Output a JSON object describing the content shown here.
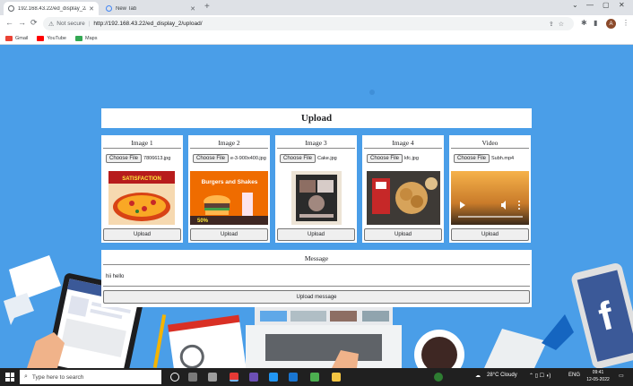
{
  "browser": {
    "tabs": [
      {
        "title": "192.168.43.22/ed_display_2/uplo",
        "active": true
      },
      {
        "title": "New Tab",
        "active": false
      }
    ],
    "new_tab": "+",
    "nav": {
      "back": "←",
      "forward": "→",
      "reload": "⟳"
    },
    "omnibox": {
      "security": "Not secure",
      "separator": "|",
      "url": "http://192.168.43.22/ed_display_2/upload/"
    },
    "avatar": "A",
    "window": {
      "minimize": "⌄",
      "restore": "—",
      "maximize": "▢",
      "close": "✕"
    }
  },
  "bookmarks": [
    {
      "label": "Gmail",
      "color": "#ea4335"
    },
    {
      "label": "YouTube",
      "color": "#ff0000"
    },
    {
      "label": "Maps",
      "color": "#34a853"
    }
  ],
  "upload": {
    "heading": "Upload",
    "cards": [
      {
        "label": "Image 1",
        "choose": "Choose File",
        "filename": "7806613.jpg",
        "upload": "Upload"
      },
      {
        "label": "Image 2",
        "choose": "Choose File",
        "filename": "e-3-900x400.jpg",
        "upload": "Upload"
      },
      {
        "label": "Image 3",
        "choose": "Choose File",
        "filename": "Cake.jpg",
        "upload": "Upload"
      },
      {
        "label": "Image 4",
        "choose": "Choose File",
        "filename": "kfc.jpg",
        "upload": "Upload"
      },
      {
        "label": "Video",
        "choose": "Choose File",
        "filename": "Subh.mp4",
        "upload": "Upload"
      }
    ],
    "image_texts": {
      "pizza": "SATISFACTION",
      "burger_title": "Burgers and Shakes",
      "burger_price": "50%"
    },
    "message": {
      "label": "Message",
      "value": "hii hello",
      "button": "Upload message"
    }
  },
  "taskbar": {
    "search_placeholder": "Type here to search",
    "weather": "28°C  Cloudy",
    "language": "ENG",
    "time": "09:41",
    "date": "12-05-2022"
  },
  "colors": {
    "page_bg": "#4a9ee8",
    "taskbar": "#202020",
    "button_bg": "#efefef"
  }
}
